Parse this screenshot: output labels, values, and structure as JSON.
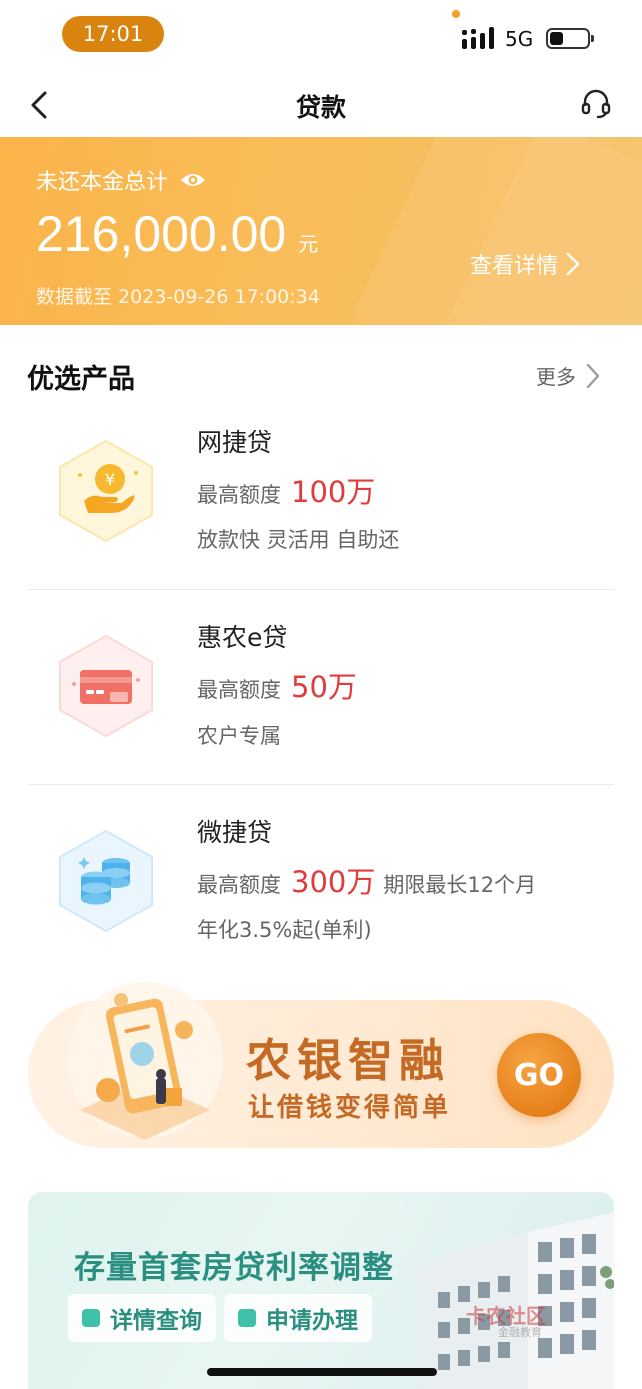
{
  "status_bar": {
    "time": "17:01",
    "network": "5G",
    "icons": [
      "signal-icon",
      "battery-icon"
    ]
  },
  "nav": {
    "title": "贷款",
    "icons": [
      "back-chevron-icon",
      "headset-service-icon"
    ]
  },
  "banner": {
    "label": "未还本金总计",
    "amount": "216,000.00",
    "unit": "元",
    "data_time": "数据截至 2023-09-26 17:00:34",
    "detail_link": "查看详情",
    "colors": {
      "from": "#fbb44a",
      "to": "#f7c066"
    }
  },
  "section": {
    "title": "优选产品",
    "more": "更多"
  },
  "products": [
    {
      "name": "网捷贷",
      "limit_label": "最高额度",
      "limit_value": "100万",
      "term": "",
      "desc": "放款快 灵活用 自助还",
      "icon": "hand-coin-icon"
    },
    {
      "name": "惠农e贷",
      "limit_label": "最高额度",
      "limit_value": "50万",
      "term": "",
      "desc": "农户专属",
      "icon": "bank-card-icon"
    },
    {
      "name": "微捷贷",
      "limit_label": "最高额度",
      "limit_value": "300万",
      "term": "期限最长12个月",
      "desc": "年化3.5%起(单利)",
      "icon": "coin-stack-icon"
    }
  ],
  "promo": {
    "title": "农银智融",
    "subtitle": "让借钱变得简单",
    "go": "GO"
  },
  "mortgage": {
    "title": "存量首套房贷利率调整",
    "chips": [
      "详情查询",
      "申请办理"
    ],
    "watermark": "卡农社区",
    "watermark_sub": "金融教育"
  },
  "accent_colors": {
    "price_red": "#e03c3c",
    "promo_brown": "#c56a25",
    "mortgage_green": "#2a8f80"
  }
}
